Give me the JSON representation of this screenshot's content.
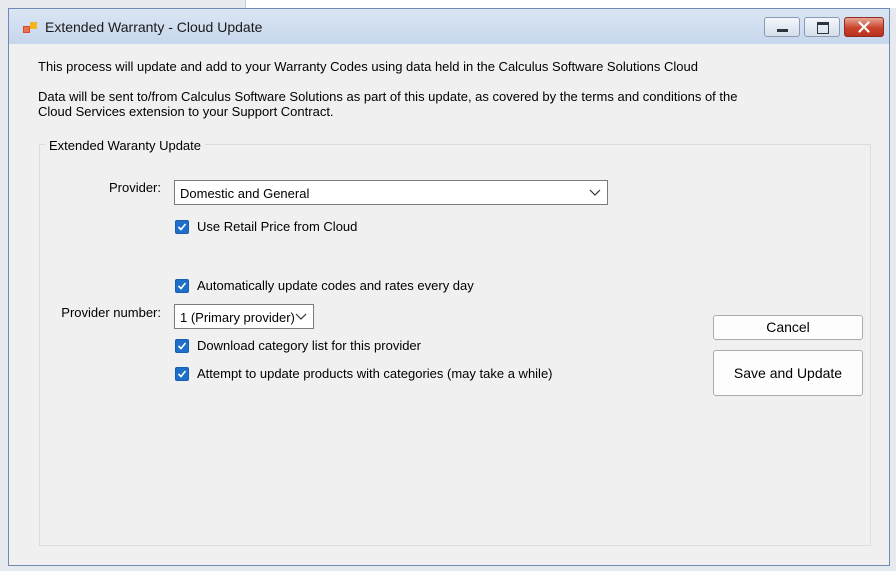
{
  "window": {
    "title": "Extended Warranty - Cloud Update"
  },
  "intro": {
    "line1": "This process will update and add to your Warranty Codes using data held in the Calculus Software Solutions Cloud",
    "line2": "Data will be sent to/from Calculus Software Solutions as part of this update, as covered by the terms and conditions of the Cloud Services extension to your Support Contract."
  },
  "group": {
    "legend": "Extended Waranty Update",
    "provider_label": "Provider:",
    "provider_value": "Domestic and General",
    "retail_price_label": "Use Retail Price from Cloud",
    "retail_price_checked": true,
    "auto_update_label": "Automatically update codes and rates every day",
    "auto_update_checked": true,
    "provider_number_label": "Provider number:",
    "provider_number_value": "1 (Primary provider)",
    "download_category_label": "Download category list for this provider",
    "download_category_checked": true,
    "attempt_update_label": "Attempt to update products with categories (may take a while)",
    "attempt_update_checked": true
  },
  "buttons": {
    "cancel": "Cancel",
    "save": "Save and Update"
  },
  "colors": {
    "checkbox_accent": "#1e6fc9",
    "close_button": "#c9432c"
  }
}
